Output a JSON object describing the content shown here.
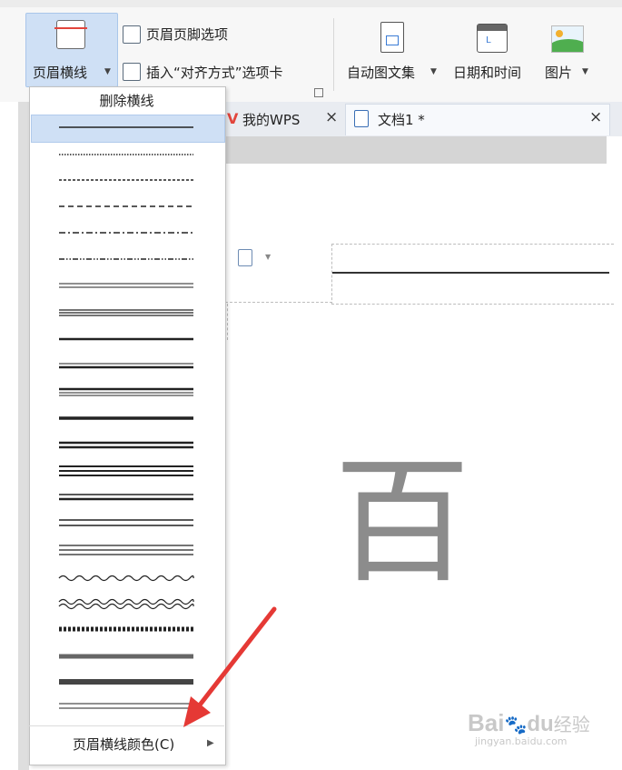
{
  "ribbon": {
    "header_line_label": "页眉横线",
    "header_footer_options_label": "页眉页脚选项",
    "insert_alignment_label": "插入“对齐方式”选项卡",
    "auto_text_label": "自动图文集",
    "date_time_label": "日期和时间",
    "picture_label": "图片"
  },
  "tabs": [
    {
      "label": "我的WPS",
      "close": "×"
    },
    {
      "label": "文档1 *",
      "close": "×"
    }
  ],
  "menu": {
    "delete_line_label": "删除横线",
    "color_label": "页眉横线颜色(C)",
    "line_styles": [
      "solid",
      "dotted",
      "dashed",
      "dash-long",
      "dash-dot",
      "dash-dot-dot",
      "double-thin",
      "triple-thin",
      "thick",
      "thin-thick",
      "thick-thin",
      "thick-double",
      "triple-thick",
      "thick-thin-thick",
      "double",
      "thin-double",
      "triple",
      "wave",
      "double-wave",
      "hatched",
      "gradient-thin",
      "gradient-thick",
      "thin-triple"
    ]
  },
  "document": {
    "body_char": "百"
  },
  "watermark": {
    "brand": "Bai",
    "brand2": "du",
    "brand3": "经验",
    "url": "jingyan.baidu.com"
  },
  "colors": {
    "accent": "#cfe0f5",
    "tab_icon_red": "#e2453c",
    "arrow_red": "#e53935"
  }
}
